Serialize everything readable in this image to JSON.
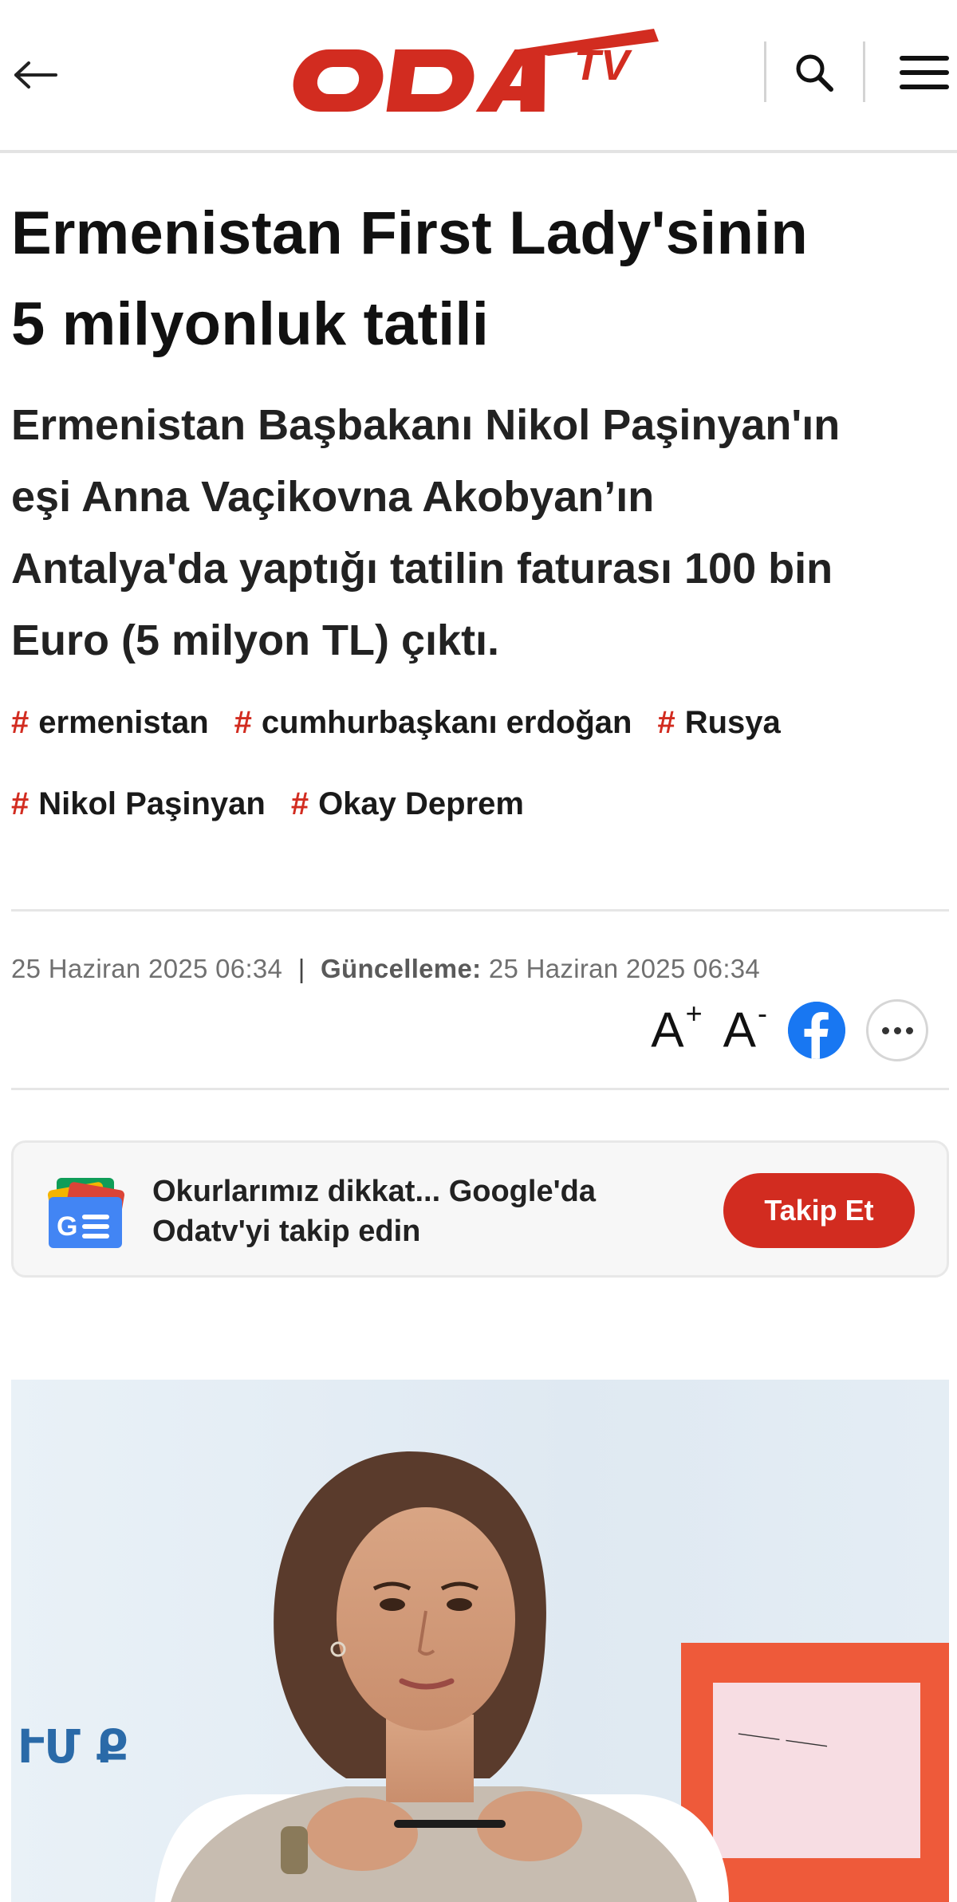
{
  "header": {
    "logo_text": "ODATV",
    "icons": {
      "back": "back-arrow-icon",
      "search": "search-icon",
      "menu": "hamburger-menu-icon"
    }
  },
  "article": {
    "title_line1": "Ermenistan First Lady'sinin",
    "title_line2": "5 milyonluk tatili",
    "lead_line1": "Ermenistan Başbakanı Nikol Paşinyan'ın",
    "lead_line2": "eşi Anna Vaçikovna Akobyan’ın",
    "lead_line3": "Antalya'da yaptığı tatilin faturası 100 bin",
    "lead_line4": "Euro (5 milyon TL) çıktı.",
    "tags": [
      "ermenistan",
      "cumhurbaşkanı erdoğan",
      "Rusya",
      "Nikol Paşinyan",
      "Okay Deprem"
    ],
    "tag_symbol": "#"
  },
  "meta": {
    "published": "25 Haziran 2025 06:34",
    "separator": "|",
    "updated_label": "Güncelleme:",
    "updated": "25 Haziran 2025 06:34"
  },
  "tools": {
    "font_increase": "A",
    "font_increase_sign": "+",
    "font_decrease": "A",
    "font_decrease_sign": "-",
    "facebook": "facebook-icon",
    "more": "more-options-icon"
  },
  "google_card": {
    "line1": "Okurlarımız dikkat... Google'da",
    "line2": "Odatv'yi takip edin",
    "button": "Takip Et",
    "icon": "google-news-icon"
  },
  "photo": {
    "backdrop_text": "ՒՄ Ք",
    "icon": "article-photo"
  },
  "colors": {
    "brand_red": "#d22c20",
    "facebook_blue": "#1877f2",
    "text_dark": "#111111",
    "meta_gray": "#707070"
  }
}
